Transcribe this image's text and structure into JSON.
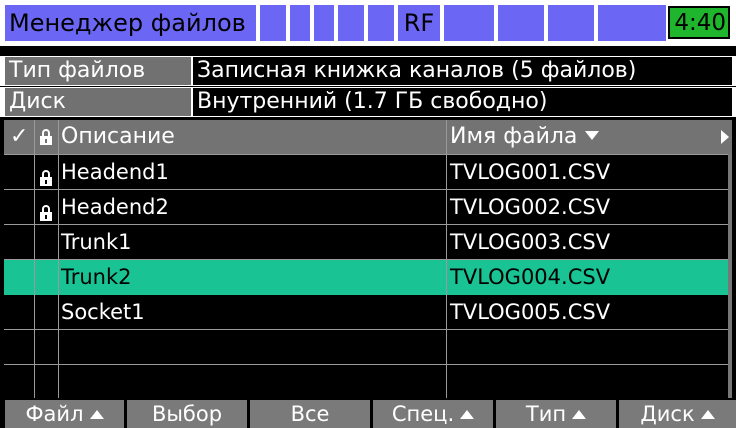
{
  "titlebar": {
    "title": "Менеджер файлов",
    "rf": "RF",
    "time": "4:40"
  },
  "info": {
    "type_label": "Тип файлов",
    "type_value": "Записная книжка каналов (5 файлов)",
    "disk_label": "Диск",
    "disk_value": "Внутренний (1.7 ГБ свободно)"
  },
  "table": {
    "headers": {
      "check": "✓",
      "description": "Описание",
      "filename": "Имя файла"
    },
    "rows": [
      {
        "locked": true,
        "description": "Headend1",
        "filename": "TVLOG001.CSV",
        "selected": false
      },
      {
        "locked": true,
        "description": "Headend2",
        "filename": "TVLOG002.CSV",
        "selected": false
      },
      {
        "locked": false,
        "description": "Trunk1",
        "filename": "TVLOG003.CSV",
        "selected": false
      },
      {
        "locked": false,
        "description": "Trunk2",
        "filename": "TVLOG004.CSV",
        "selected": true
      },
      {
        "locked": false,
        "description": "Socket1",
        "filename": "TVLOG005.CSV",
        "selected": false
      },
      {
        "locked": false,
        "description": "",
        "filename": "",
        "selected": false
      },
      {
        "locked": false,
        "description": "",
        "filename": "",
        "selected": false
      }
    ]
  },
  "footer": {
    "file": "Файл",
    "select": "Выбор",
    "all": "Все",
    "spec": "Спец.",
    "type": "Тип",
    "disk": "Диск"
  },
  "colors": {
    "accent": "#19c394",
    "title_bg": "#6b66f4",
    "clock_bg": "#1fb52d"
  }
}
